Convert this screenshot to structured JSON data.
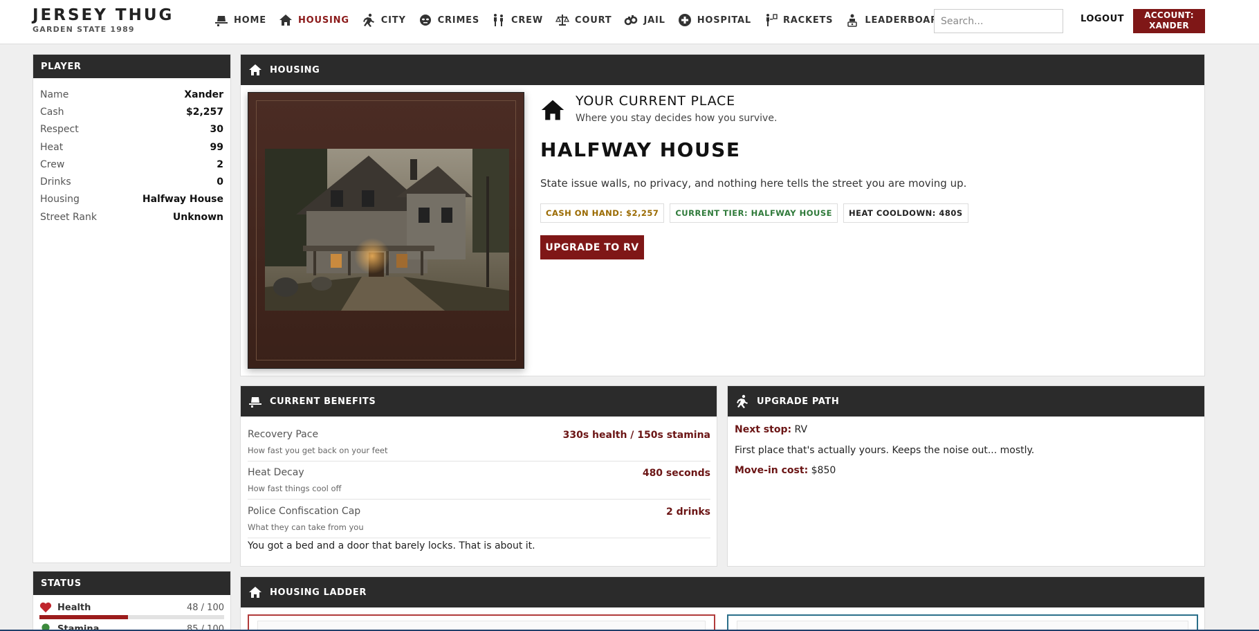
{
  "brand": {
    "title": "JERSEY THUG",
    "subtitle": "GARDEN STATE 1989"
  },
  "nav": [
    {
      "label": "HOME",
      "icon": "hat-icon",
      "active": false
    },
    {
      "label": "HOUSING",
      "icon": "house-icon",
      "active": true
    },
    {
      "label": "CITY",
      "icon": "runner-icon",
      "active": false
    },
    {
      "label": "CRIMES",
      "icon": "mask-icon",
      "active": false
    },
    {
      "label": "CREW",
      "icon": "crew-icon",
      "active": false
    },
    {
      "label": "COURT",
      "icon": "scales-icon",
      "active": false
    },
    {
      "label": "JAIL",
      "icon": "handcuffs-icon",
      "active": false
    },
    {
      "label": "HOSPITAL",
      "icon": "medical-cross-icon",
      "active": false
    },
    {
      "label": "RACKETS",
      "icon": "dealer-icon",
      "active": false
    },
    {
      "label": "LEADERBOARD",
      "icon": "trophy-person-icon",
      "active": false
    }
  ],
  "search": {
    "placeholder": "Search...",
    "value": ""
  },
  "header": {
    "logout": "LOGOUT",
    "account_line1": "ACCOUNT:",
    "account_line2": "XANDER"
  },
  "player": {
    "title": "PLAYER",
    "rows": [
      {
        "k": "Name",
        "v": "Xander"
      },
      {
        "k": "Cash",
        "v": "$2,257"
      },
      {
        "k": "Respect",
        "v": "30"
      },
      {
        "k": "Heat",
        "v": "99"
      },
      {
        "k": "Crew",
        "v": "2"
      },
      {
        "k": "Drinks",
        "v": "0"
      },
      {
        "k": "Housing",
        "v": "Halfway House"
      },
      {
        "k": "Street Rank",
        "v": "Unknown"
      }
    ]
  },
  "status": {
    "title": "STATUS",
    "health": {
      "label": "Health",
      "value": "48 / 100",
      "fraction": 0.48
    },
    "stamina": {
      "label": "Stamina",
      "value": "85 / 100",
      "fraction": 0.85
    }
  },
  "housing": {
    "title": "HOUSING",
    "place_title": "YOUR CURRENT PLACE",
    "place_subtitle": "Where you stay decides how you survive.",
    "name": "HALFWAY HOUSE",
    "description": "State issue walls, no privacy, and nothing here tells the street you are moving up.",
    "badges": [
      {
        "text": "CASH ON HAND: $2,257",
        "color": "#9a6a00"
      },
      {
        "text": "CURRENT TIER: HALFWAY HOUSE",
        "color": "#2f7a3a"
      },
      {
        "text": "HEAT COOLDOWN: 480S",
        "color": "#222222"
      }
    ],
    "upgrade_button": "UPGRADE TO RV"
  },
  "benefits": {
    "title": "CURRENT BENEFITS",
    "items": [
      {
        "label": "Recovery Pace",
        "sub": "How fast you get back on your feet",
        "value": "330s health / 150s stamina"
      },
      {
        "label": "Heat Decay",
        "sub": "How fast things cool off",
        "value": "480 seconds"
      },
      {
        "label": "Police Confiscation Cap",
        "sub": "What they can take from you",
        "value": "2 drinks"
      }
    ],
    "note": "You got a bed and a door that barely locks. That is about it."
  },
  "upgrade_path": {
    "title": "UPGRADE PATH",
    "next_label": "Next stop:",
    "next_value": "RV",
    "description": "First place that's actually yours. Keeps the noise out... mostly.",
    "cost_label": "Move-in cost:",
    "cost_value": "$850"
  },
  "ladder": {
    "title": "HOUSING LADDER"
  },
  "colors": {
    "accent": "#7f1717",
    "dark": "#2b2b2b",
    "ladder_left": "#b13a3a",
    "ladder_right": "#2a6f8a"
  }
}
